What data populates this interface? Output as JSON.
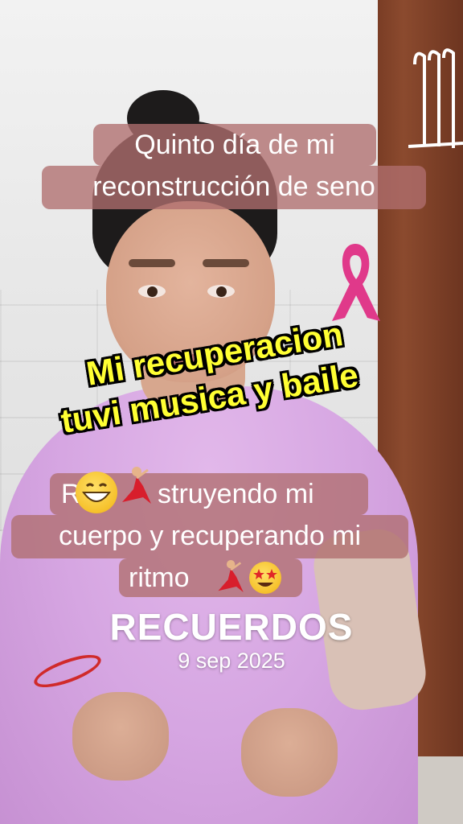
{
  "captions": {
    "top_line1": "Quinto día de mi",
    "top_line2": "reconstrucción de seno",
    "yellow_line1": "Mi recuperacion",
    "yellow_line2": "tuvi musica y baile",
    "mid_line1_visible": "struyendo mi",
    "mid_line1_prefix": "R",
    "mid_line2": "cuerpo y recuperando mi",
    "mid_line3": "ritmo"
  },
  "memories": {
    "title": "RECUERDOS",
    "date": "9 sep 2025"
  },
  "icons": {
    "ribbon": "pink-ribbon-icon",
    "grin": "grinning-face-emoji",
    "dancer": "dancer-emoji",
    "star_eyes": "star-struck-emoji"
  },
  "colors": {
    "caption_bg": "#af6e6e",
    "yellow_text": "#ffff33",
    "ribbon": "#e0398a"
  }
}
